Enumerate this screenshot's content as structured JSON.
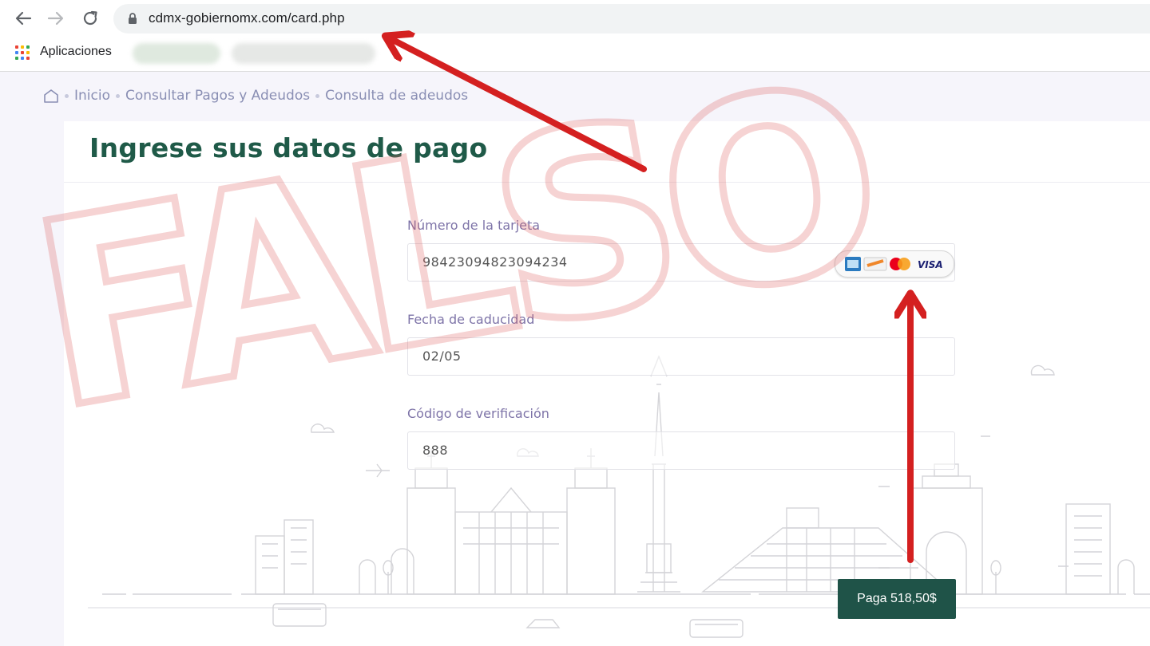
{
  "browser": {
    "url": "cdmx-gobiernomx.com/card.php",
    "bookmarks": {
      "apps_label": "Aplicaciones"
    }
  },
  "breadcrumb": {
    "items": [
      "Inicio",
      "Consultar Pagos y Adeudos",
      "Consulta de adeudos"
    ]
  },
  "form": {
    "title": "Ingrese sus datos de pago",
    "card_number": {
      "label": "Número de la tarjeta",
      "value": "98423094823094234"
    },
    "expiry": {
      "label": "Fecha de caducidad",
      "value": "02/05"
    },
    "cvv": {
      "label": "Código de verificación",
      "value": "888"
    },
    "accepted_cards": [
      "amex-icon",
      "discover-icon",
      "mastercard-icon",
      "visa-icon"
    ],
    "visa_text": "VISA",
    "pay_button": "Paga 518,50$"
  },
  "overlay": {
    "stamp_text": "FALSO",
    "stamp_color": "#e06060",
    "arrow_color": "#d42020"
  },
  "colors": {
    "title": "#1f5a48",
    "button": "#1f5348",
    "label": "#7e74a8"
  }
}
